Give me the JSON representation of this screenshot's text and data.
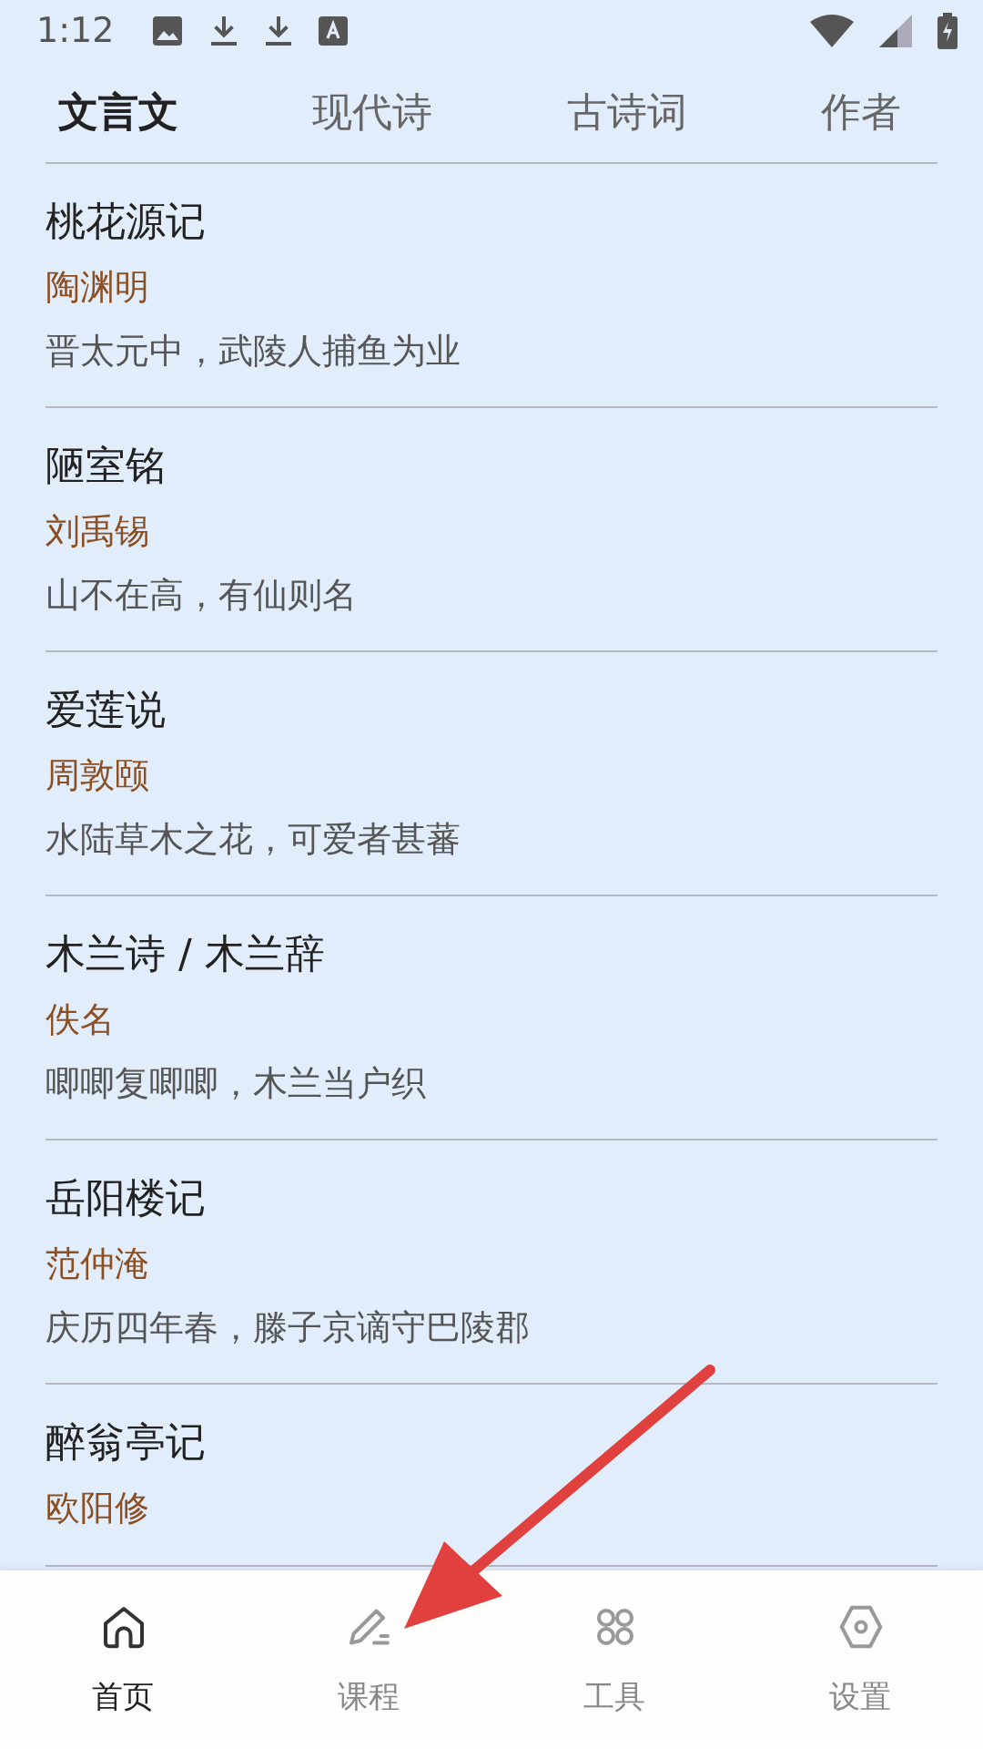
{
  "status_bar": {
    "time": "1:12"
  },
  "tabs": [
    {
      "label": "文言文",
      "selected": true
    },
    {
      "label": "现代诗",
      "selected": false
    },
    {
      "label": "古诗词",
      "selected": false
    },
    {
      "label": "作者",
      "selected": false
    }
  ],
  "works": [
    {
      "title": "桃花源记",
      "author": "陶渊明",
      "excerpt": "晋太元中，武陵人捕鱼为业"
    },
    {
      "title": "陋室铭",
      "author": "刘禹锡",
      "excerpt": "山不在高，有仙则名"
    },
    {
      "title": "爱莲说",
      "author": "周敦颐",
      "excerpt": "水陆草木之花，可爱者甚蕃"
    },
    {
      "title": "木兰诗 / 木兰辞",
      "author": "佚名",
      "excerpt": "唧唧复唧唧，木兰当户织"
    },
    {
      "title": "岳阳楼记",
      "author": "范仲淹",
      "excerpt": "庆历四年春，滕子京谪守巴陵郡"
    },
    {
      "title": "醉翁亭记",
      "author": "欧阳修"
    }
  ],
  "bottom_nav": [
    {
      "kind": "home",
      "label": "首页",
      "selected": true
    },
    {
      "kind": "course",
      "label": "课程",
      "selected": false
    },
    {
      "kind": "tools",
      "label": "工具",
      "selected": false
    },
    {
      "kind": "settings",
      "label": "设置",
      "selected": false
    }
  ]
}
